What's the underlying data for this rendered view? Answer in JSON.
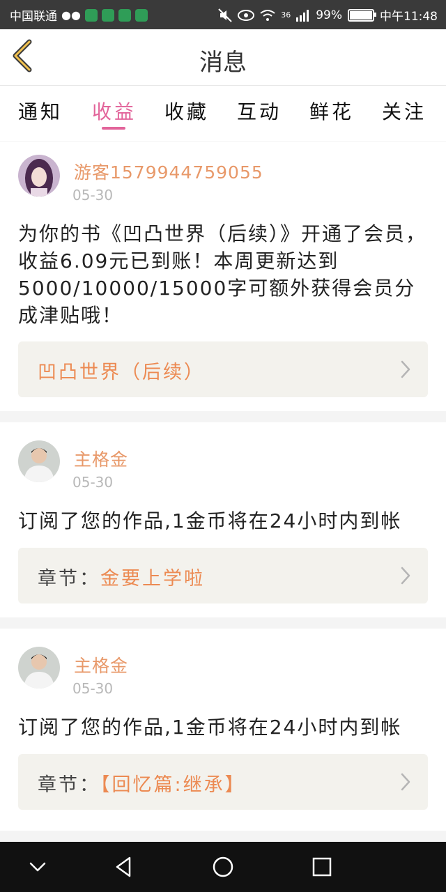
{
  "status_bar": {
    "carrier": "中国联通",
    "signal": "36",
    "battery": "99%",
    "battery_level": 0.99,
    "time": "中午11:48"
  },
  "header": {
    "title": "消息"
  },
  "tabs": [
    {
      "label": "通知",
      "active": false
    },
    {
      "label": "收益",
      "active": true
    },
    {
      "label": "收藏",
      "active": false
    },
    {
      "label": "互动",
      "active": false
    },
    {
      "label": "鲜花",
      "active": false
    },
    {
      "label": "关注",
      "active": false
    }
  ],
  "messages": [
    {
      "user": "游客1579944759055",
      "date": "05-30",
      "text": "为你的书《凹凸世界（后续）》开通了会员，收益6.09元已到账！本周更新达到5000/10000/15000字可额外获得会员分成津贴哦！",
      "link_prefix": "",
      "link_value": "凹凸世界（后续）"
    },
    {
      "user": "主格金",
      "date": "05-30",
      "text": "订阅了您的作品,1金币将在24小时内到帐",
      "link_prefix": "章节：",
      "link_value": "金要上学啦"
    },
    {
      "user": "主格金",
      "date": "05-30",
      "text": "订阅了您的作品,1金币将在24小时内到帐",
      "link_prefix": "章节：",
      "link_value": "【回忆篇:继承】"
    }
  ],
  "colors": {
    "accent": "#e2649a",
    "username": "#e8996a",
    "link": "#ec8a52"
  },
  "icons": {
    "back": "chevron-left-icon",
    "chevron": "chevron-right-icon",
    "nav_back": "triangle-back-icon",
    "nav_home": "circle-home-icon",
    "nav_recent": "square-recent-icon",
    "nav_hide": "chevron-down-icon"
  }
}
